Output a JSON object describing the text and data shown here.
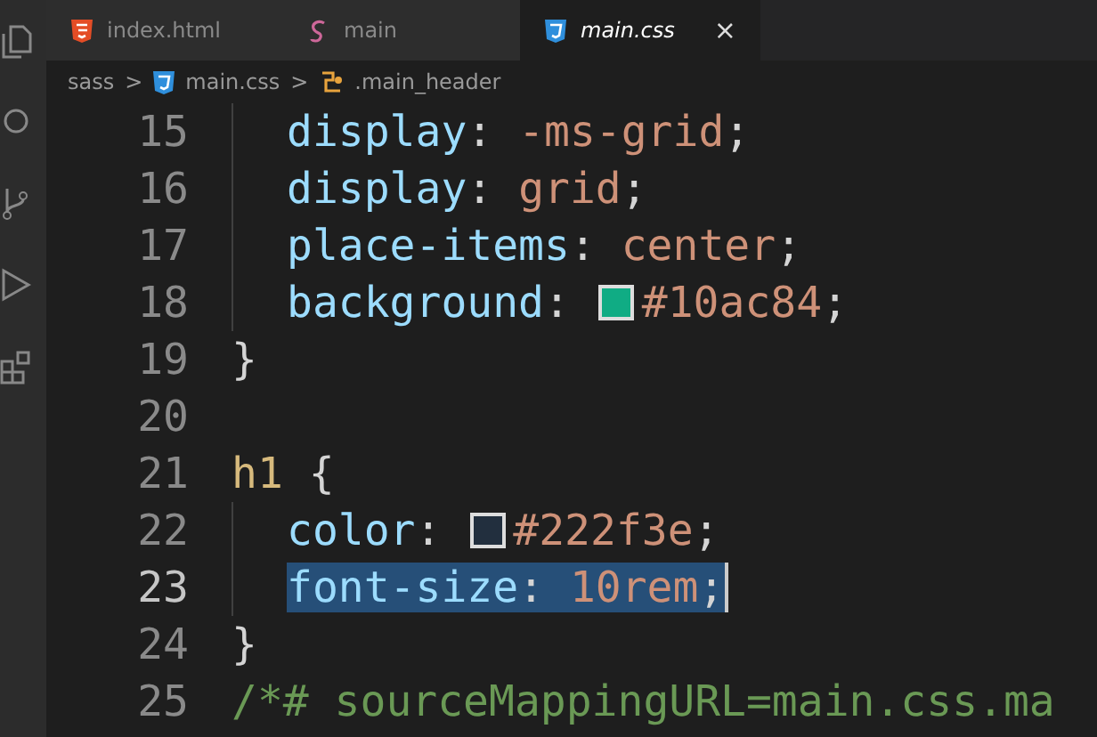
{
  "tabs": [
    {
      "label": "index.html",
      "kind": "html",
      "selected": false
    },
    {
      "label": "main",
      "kind": "scss",
      "selected": false
    },
    {
      "label": "main.css",
      "kind": "css",
      "selected": true,
      "close": "×"
    }
  ],
  "breadcrumb": [
    {
      "label": "sass",
      "kind": "folder"
    },
    {
      "label": "main.css",
      "kind": "css"
    },
    {
      "label": ".main_header",
      "kind": "selector"
    }
  ],
  "separators": [
    ">",
    ">"
  ],
  "lines": [
    {
      "number": "15",
      "indent": true,
      "selected": false,
      "tokens": [
        {
          "kind": "property",
          "text": "display"
        },
        {
          "kind": "punct",
          "text": ": "
        },
        {
          "kind": "value",
          "text": "-ms-grid"
        },
        {
          "kind": "punct",
          "text": ";"
        }
      ]
    },
    {
      "number": "16",
      "indent": true,
      "selected": false,
      "tokens": [
        {
          "kind": "property",
          "text": "display"
        },
        {
          "kind": "punct",
          "text": ": "
        },
        {
          "kind": "value",
          "text": "grid"
        },
        {
          "kind": "punct",
          "text": ";"
        }
      ]
    },
    {
      "number": "17",
      "indent": true,
      "selected": false,
      "tokens": [
        {
          "kind": "property",
          "text": "place-items"
        },
        {
          "kind": "punct",
          "text": ": "
        },
        {
          "kind": "value",
          "text": "center"
        },
        {
          "kind": "punct",
          "text": ";"
        }
      ]
    },
    {
      "number": "18",
      "indent": true,
      "selected": false,
      "tokens": [
        {
          "kind": "property",
          "text": "background"
        },
        {
          "kind": "punct",
          "text": ": "
        },
        {
          "kind": "swatch",
          "color": "#10ac84"
        },
        {
          "kind": "value",
          "text": "#10ac84"
        },
        {
          "kind": "punct",
          "text": ";"
        }
      ]
    },
    {
      "number": "19",
      "indent": false,
      "selected": false,
      "tokens": [
        {
          "kind": "punct",
          "text": "}"
        }
      ]
    },
    {
      "number": "20",
      "indent": false,
      "selected": false
    },
    {
      "number": "21",
      "indent": false,
      "selected": false,
      "tokens": [
        {
          "kind": "selector",
          "text": "h1"
        },
        {
          "kind": "punct",
          "text": " {"
        }
      ]
    },
    {
      "number": "22",
      "indent": true,
      "selected": false,
      "tokens": [
        {
          "kind": "property",
          "text": "color"
        },
        {
          "kind": "punct",
          "text": ": "
        },
        {
          "kind": "swatch",
          "color": "#222f3e"
        },
        {
          "kind": "value",
          "text": "#222f3e"
        },
        {
          "kind": "punct",
          "text": ";"
        }
      ]
    },
    {
      "number": "23",
      "indent": true,
      "selected": true,
      "tokens": [
        {
          "kind": "property",
          "text": "font-size"
        },
        {
          "kind": "punct",
          "text": ": "
        },
        {
          "kind": "value",
          "text": "10rem"
        },
        {
          "kind": "punct",
          "text": ";"
        }
      ]
    },
    {
      "number": "24",
      "indent": false,
      "selected": false,
      "tokens": [
        {
          "kind": "punct",
          "text": "}"
        }
      ]
    },
    {
      "number": "25",
      "indent": false,
      "selected": false,
      "tokens": [
        {
          "kind": "comment",
          "text": "/*# sourceMappingURL=main.css.ma"
        }
      ]
    }
  ]
}
